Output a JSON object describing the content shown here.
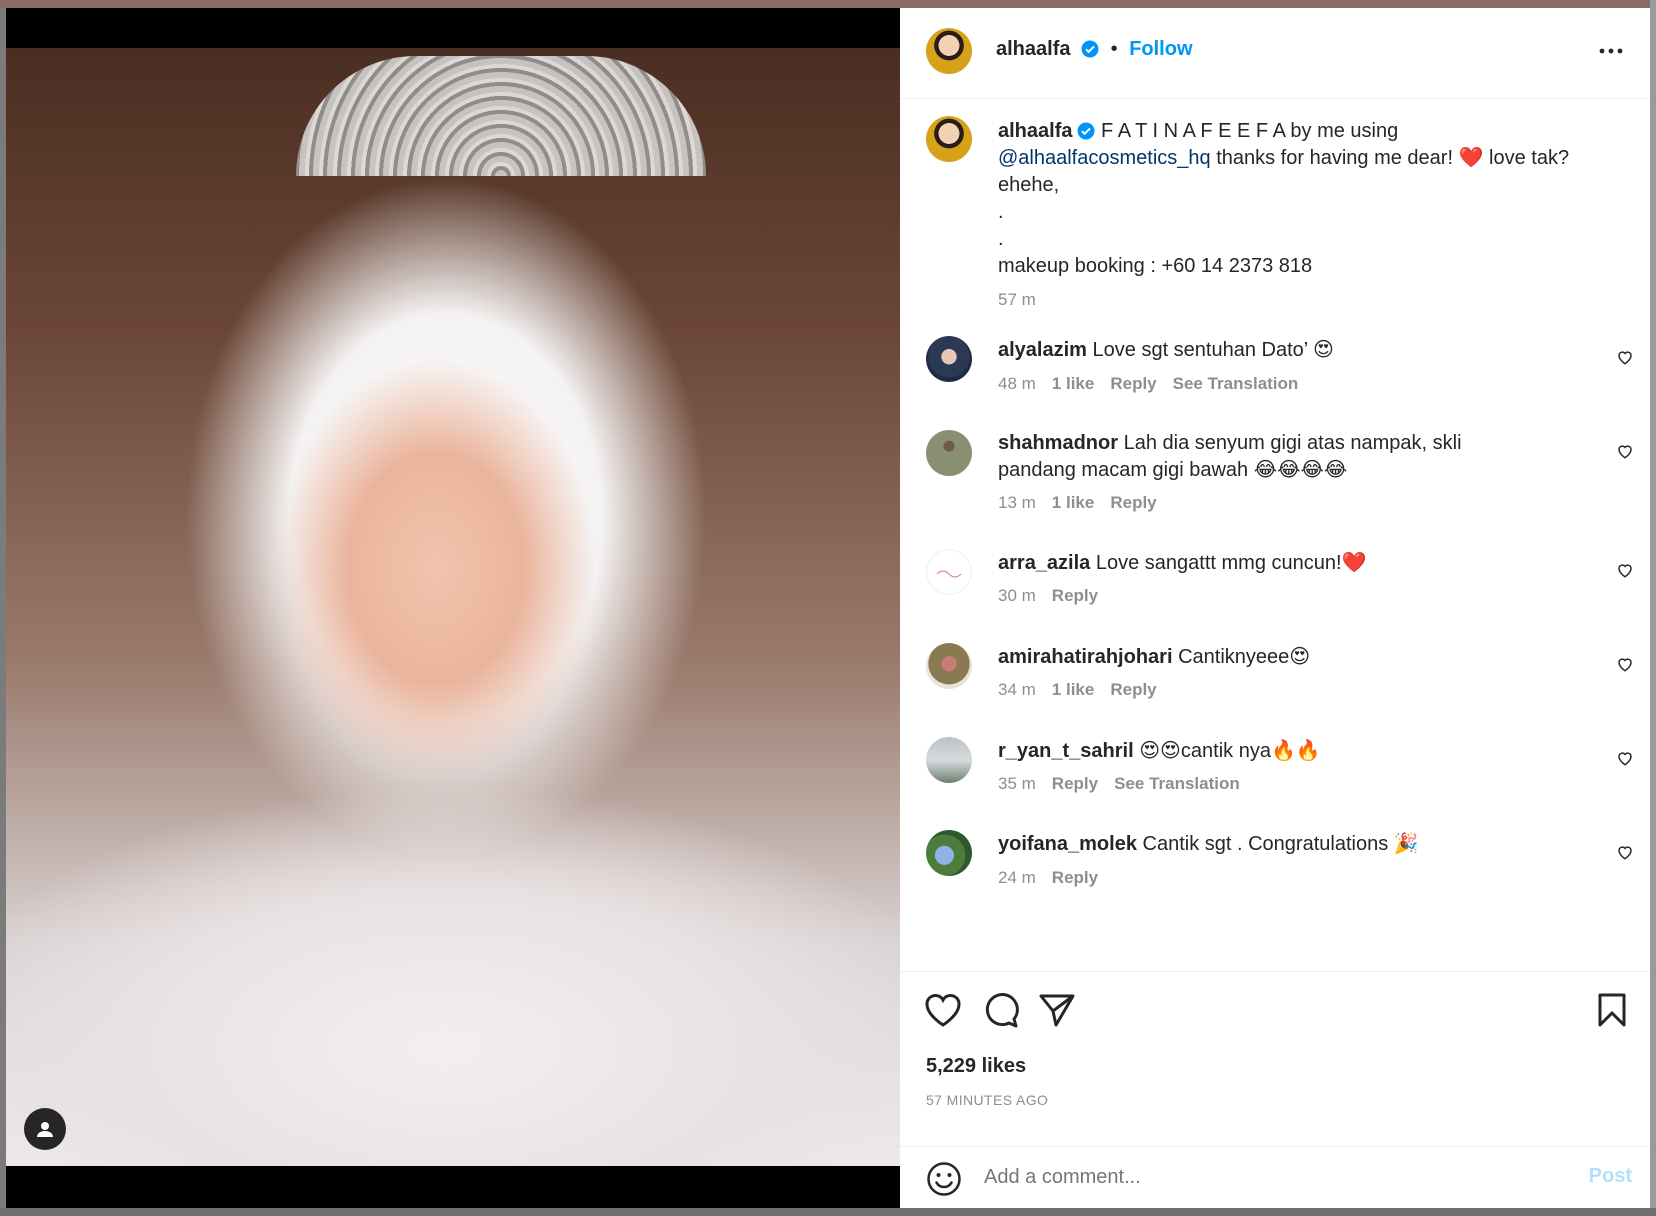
{
  "colors": {
    "accent": "#0095f6",
    "muted": "#8e8e8e",
    "text": "#262626",
    "mention": "#00376b",
    "heart_red": "#ed4956"
  },
  "header": {
    "username": "alhaalfa",
    "separator": "•",
    "follow_label": "Follow",
    "more_icon": "more-horizontal-icon"
  },
  "caption": {
    "username": "alhaalfa",
    "text_part1": "F A T I N A F E E F A by me using",
    "mention": "@alhaalfacosmetics_hq",
    "text_part2": "thanks for having me dear! ❤️ love tak? ehehe,",
    "dot1": ".",
    "dot2": ".",
    "booking": "makeup booking : +60 14 2373 818",
    "time": "57 m"
  },
  "comments": [
    {
      "username": "alyalazim",
      "text": "Love sgt sentuhan Dato’ 😍",
      "time": "48 m",
      "likes": "1 like",
      "reply": "Reply",
      "translate": "See Translation"
    },
    {
      "username": "shahmadnor",
      "text": "Lah dia senyum gigi atas nampak, skli pandang macam gigi bawah 😂😂😂😂",
      "time": "13 m",
      "likes": "1 like",
      "reply": "Reply",
      "translate": ""
    },
    {
      "username": "arra_azila",
      "text": "Love sangattt mmg cuncun!❤️",
      "time": "30 m",
      "likes": "",
      "reply": "Reply",
      "translate": ""
    },
    {
      "username": "amirahatirahjohari",
      "text": "Cantiknyeee😍",
      "time": "34 m",
      "likes": "1 like",
      "reply": "Reply",
      "translate": ""
    },
    {
      "username": "r_yan_t_sahril",
      "text": "😍😍cantik nya🔥🔥",
      "time": "35 m",
      "likes": "",
      "reply": "Reply",
      "translate": "See Translation"
    },
    {
      "username": "yoifana_molek",
      "text": "Cantik sgt . Congratulations 🎉",
      "time": "24 m",
      "likes": "",
      "reply": "Reply",
      "translate": ""
    }
  ],
  "likes": "5,229 likes",
  "posted": "57 MINUTES AGO",
  "add_comment": {
    "placeholder": "Add a comment...",
    "post_label": "Post"
  }
}
